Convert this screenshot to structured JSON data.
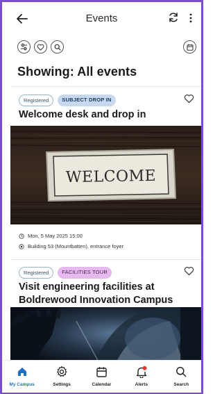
{
  "header": {
    "title": "Events"
  },
  "showing": "Showing: All events",
  "events": [
    {
      "tags": [
        "Registered",
        "SUBJECT DROP IN"
      ],
      "title": "Welcome desk and drop in",
      "image_text": "WELCOME",
      "date": "Mon, 5 May 2025 15:00",
      "location": "Building 53 (Mountbatten), entrance foyer"
    },
    {
      "tags": [
        "Registered",
        "FACILITIES TOUR"
      ],
      "title": "Visit engineering facilities at Boldrewood Innovation Campus"
    }
  ],
  "bottom_nav": [
    {
      "label": "My Campus",
      "icon": "home-icon",
      "active": true
    },
    {
      "label": "Settings",
      "icon": "gear-icon",
      "active": false
    },
    {
      "label": "Calendar",
      "icon": "calendar-icon",
      "active": false
    },
    {
      "label": "Alerts",
      "icon": "bell-icon",
      "active": false
    },
    {
      "label": "Search",
      "icon": "search-icon",
      "active": false
    }
  ],
  "colors": {
    "accent": "#1f6fc2",
    "frame": "#7a4fc9",
    "subject_tag": "#c7d8ef",
    "facilities_tag": "#e6b9ef",
    "alert_dot": "#e53935"
  }
}
